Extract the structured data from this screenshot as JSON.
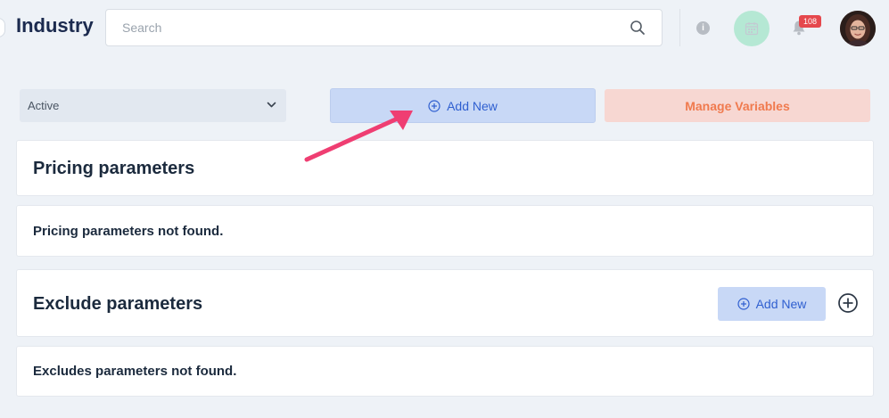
{
  "header": {
    "title": "Industry",
    "search": {
      "placeholder": "Search",
      "value": ""
    },
    "notifications": {
      "count": "108"
    },
    "icons": [
      "info-icon",
      "calendar-icon",
      "bell-icon",
      "avatar"
    ]
  },
  "toolbar": {
    "status_select": {
      "value": "Active"
    },
    "add_new_label": "Add New",
    "manage_variables_label": "Manage Variables"
  },
  "pricing": {
    "title": "Pricing parameters",
    "empty_message": "Pricing parameters not found."
  },
  "exclude": {
    "title": "Exclude parameters",
    "add_new_label": "Add New",
    "empty_message": "Excludes parameters not found."
  },
  "colors": {
    "background": "#eef2f7",
    "primary_soft": "#c8d8f6",
    "primary_text": "#2f5fd0",
    "warning_soft": "#f7d7d2",
    "warning_text": "#f07a4e",
    "badge": "#e5484d",
    "annotation_arrow": "#ef3e72",
    "calendar_bg": "#b5e8d4"
  }
}
